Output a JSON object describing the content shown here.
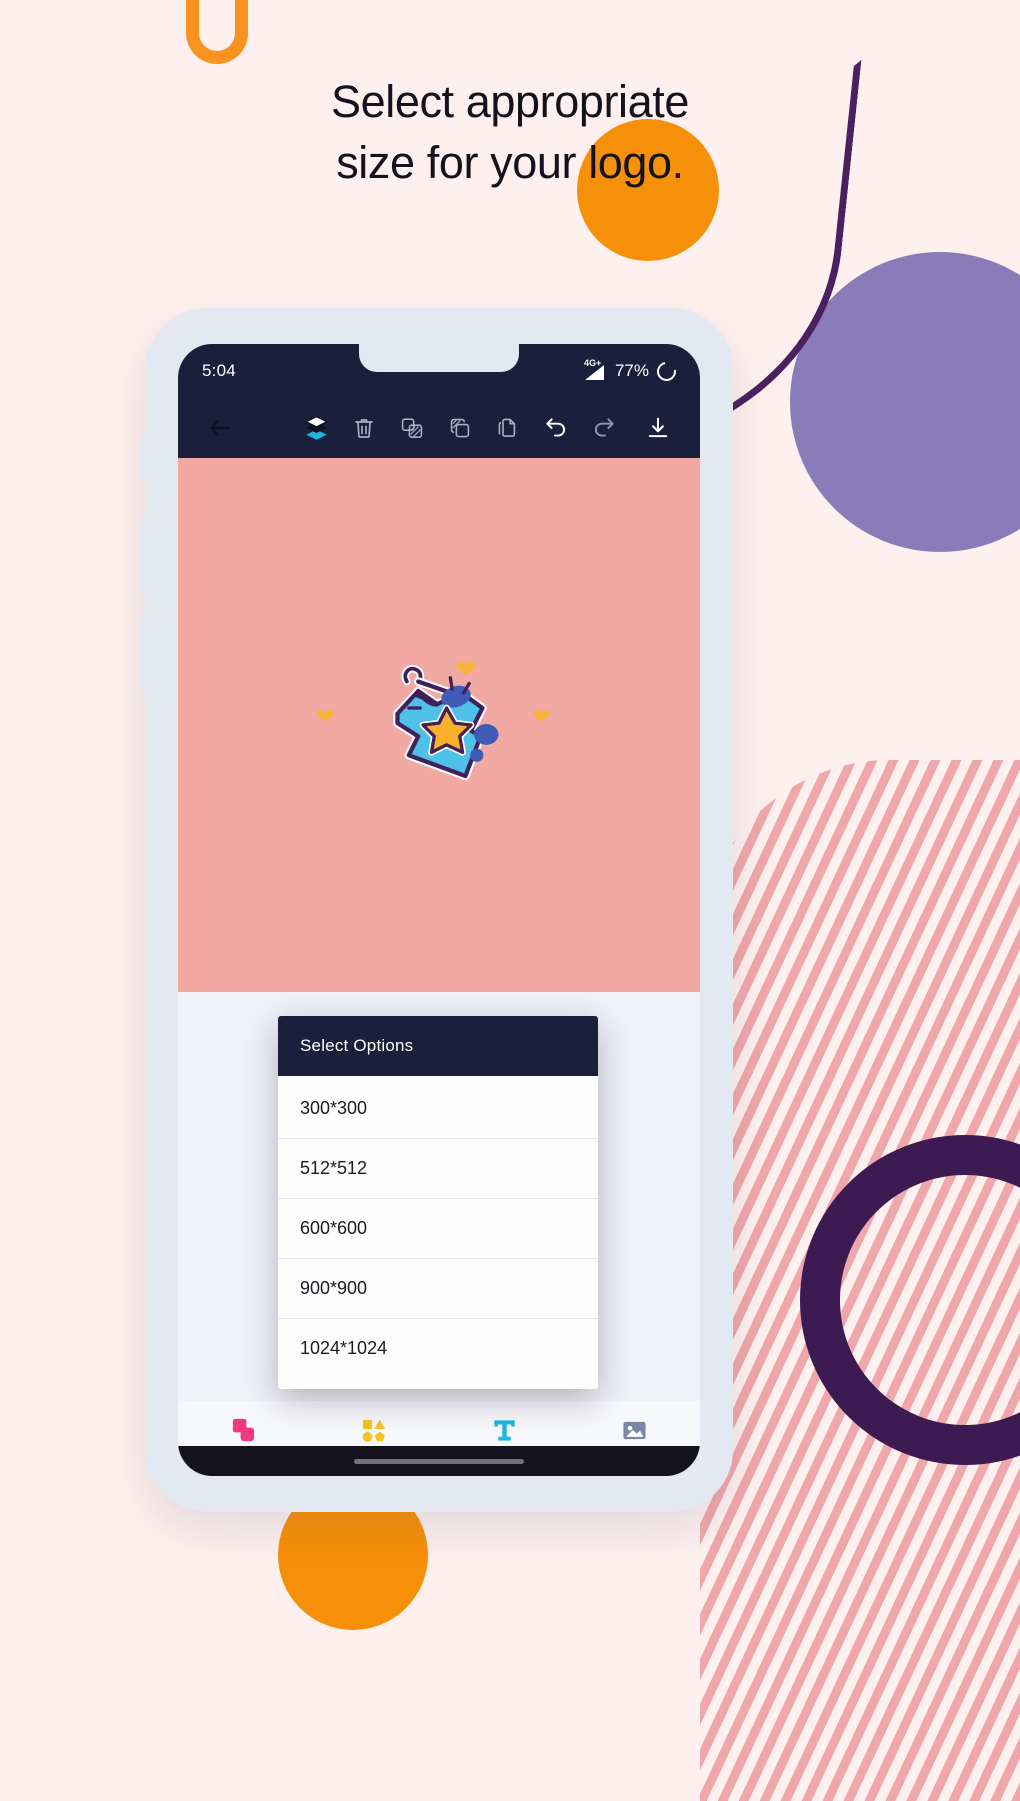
{
  "headline": {
    "line1": "Select appropriate",
    "line2": "size for your logo."
  },
  "phone": {
    "status_bar": {
      "time": "5:04",
      "network_label": "4G+",
      "battery_percent": "77%",
      "bg_color": "#1a1f3c"
    },
    "toolbar": {
      "bg_color": "#1a1f3c",
      "active_color": "#19b6e0",
      "buttons": [
        {
          "name": "back-arrow-icon",
          "label": "Back"
        },
        {
          "name": "layers-icon",
          "label": "Layers"
        },
        {
          "name": "trash-icon",
          "label": "Delete"
        },
        {
          "name": "mask-icon",
          "label": "Mask"
        },
        {
          "name": "merge-layers-icon",
          "label": "Merge"
        },
        {
          "name": "duplicate-icon",
          "label": "Duplicate"
        },
        {
          "name": "undo-icon",
          "label": "Undo"
        },
        {
          "name": "redo-icon",
          "label": "Redo"
        },
        {
          "name": "download-icon",
          "label": "Save"
        }
      ]
    },
    "canvas": {
      "bg_color": "#f2a8a3",
      "sticker_name": "tshirt-sticker",
      "decor_hearts": 3
    },
    "dialog": {
      "title": "Select Options",
      "options": [
        "300*300",
        "512*512",
        "600*600",
        "900*900",
        "1024*1024"
      ]
    },
    "bottom_nav": {
      "items": [
        {
          "label": "Wallpaper",
          "icon": "wallpaper-icon",
          "color": "#ef3a7f",
          "active": true
        },
        {
          "label": "Sticker",
          "icon": "sticker-icon",
          "color": "#f7c122",
          "active": false
        },
        {
          "label": "Text",
          "icon": "text-icon",
          "color": "#1fb6e0",
          "active": false
        },
        {
          "label": "Image",
          "icon": "image-icon",
          "color": "#7b86a6",
          "active": false
        }
      ]
    }
  },
  "theme": {
    "page_bg": "#fdf0ee",
    "phone_body": "#e3e8f1",
    "orange": "#f79009",
    "purple": "#3d1a52",
    "lavender": "#8a7cb8",
    "stripe_pink": "#f0a7ab"
  }
}
